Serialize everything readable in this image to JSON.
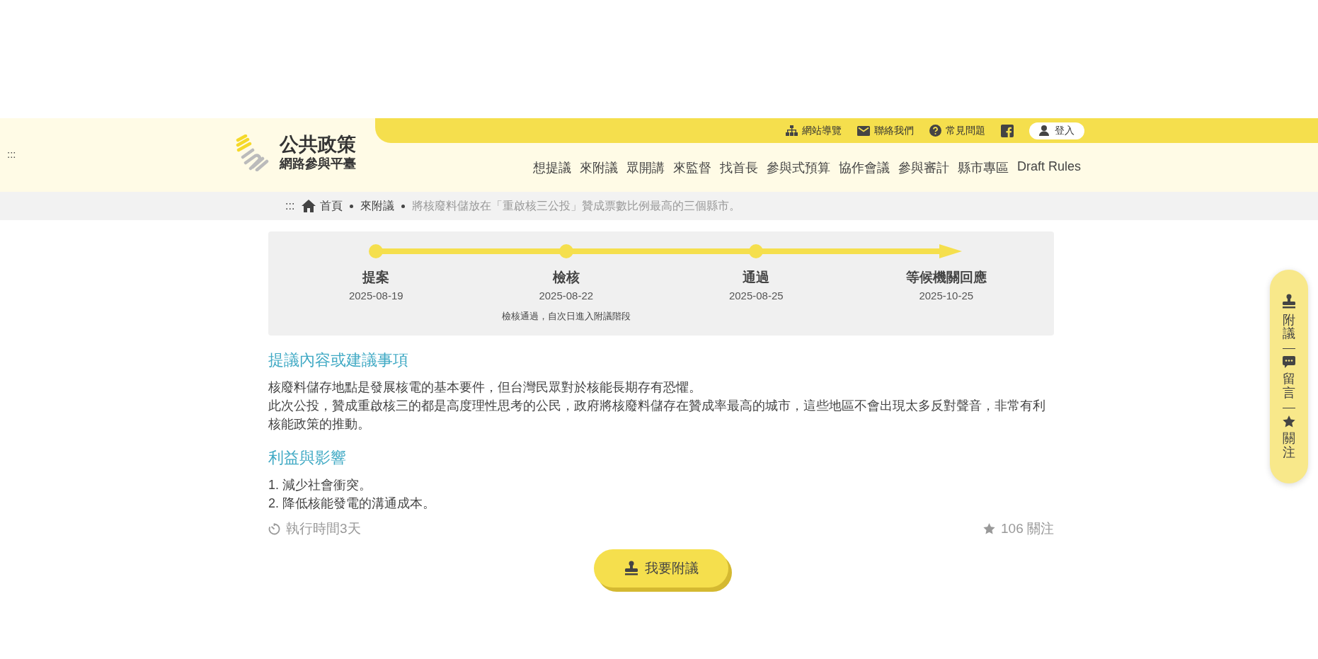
{
  "header": {
    "skip_link": ":::",
    "logo": {
      "title": "公共政策",
      "subtitle": "網路參與平臺"
    },
    "utility_links": [
      {
        "kind": "text",
        "label": "網站導覽"
      },
      {
        "kind": "text",
        "label": "聯絡我們"
      },
      {
        "kind": "text",
        "label": "常見問題"
      },
      {
        "kind": "social"
      }
    ],
    "login": {
      "label": "登入"
    },
    "nav": [
      "想提議",
      "來附議",
      "眾開講",
      "來監督",
      "找首長",
      "參與式預算",
      "協作會議",
      "參與審計",
      "縣市專區",
      "Draft Rules"
    ]
  },
  "breadcrumb": {
    "skip_link": ":::",
    "items": [
      "首頁",
      "來附議",
      "將核廢料儲放在「重啟核三公投」贊成票數比例最高的三個縣市。"
    ]
  },
  "progress": {
    "steps": [
      {
        "kind": "dot",
        "label": "提案",
        "date": "2025-08-19"
      },
      {
        "kind": "dot",
        "label": "檢核",
        "date": "2025-08-22",
        "note": "檢核通過，自次日進入附議階段"
      },
      {
        "kind": "dot",
        "label": "通過",
        "date": "2025-08-25"
      },
      {
        "kind": "arrow",
        "label": "等候機關回應",
        "date": "2025-10-25"
      }
    ]
  },
  "sections": [
    {
      "heading": "提議內容或建議事項",
      "lines": [
        "核廢料儲存地點是發展核電的基本要件，但台灣民眾對於核能長期存有恐懼。",
        "此次公投，贊成重啟核三的都是高度理性思考的公民，政府將核廢料儲存在贊成率最高的城市，這些地區不會出現太多反對聲音，非常有利核能政策的推動。"
      ]
    },
    {
      "heading": "利益與影響",
      "lines": [
        "1. 減少社會衝突。",
        "2. 降低核能發電的溝通成本。"
      ]
    }
  ],
  "meta": {
    "duration": "執行時間3天",
    "followers": "106 關注"
  },
  "endorse_button": "我要附議",
  "side_menu": [
    {
      "label": "附議"
    },
    {
      "label": "留言"
    },
    {
      "label": "關注"
    }
  ]
}
